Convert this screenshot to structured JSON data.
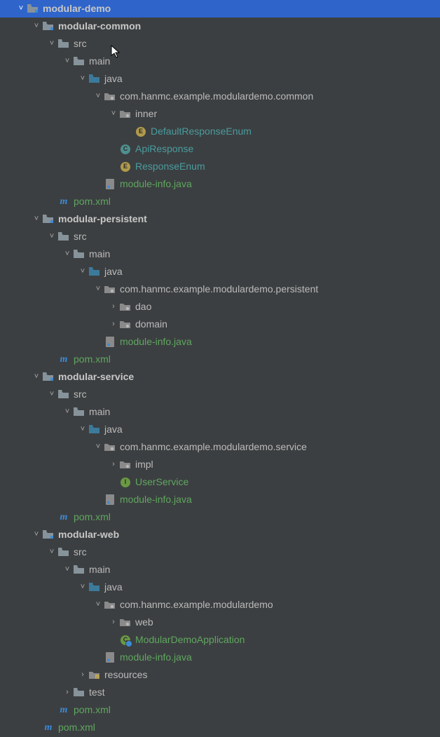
{
  "rows": [
    {
      "depth": 1,
      "arrow": "down",
      "icon": "module",
      "label": "modular-demo",
      "bold": true,
      "selected": true
    },
    {
      "depth": 2,
      "arrow": "down",
      "icon": "module",
      "label": "modular-common",
      "bold": true
    },
    {
      "depth": 3,
      "arrow": "down",
      "icon": "folder",
      "label": "src"
    },
    {
      "depth": 4,
      "arrow": "down",
      "icon": "folder",
      "label": "main"
    },
    {
      "depth": 5,
      "arrow": "down",
      "icon": "src",
      "label": "java"
    },
    {
      "depth": 6,
      "arrow": "down",
      "icon": "pkg",
      "label": "com.hanmc.example.modulardemo.common"
    },
    {
      "depth": 7,
      "arrow": "down",
      "icon": "pkg",
      "label": "inner"
    },
    {
      "depth": 8,
      "arrow": "",
      "icon": "enum",
      "label": "DefaultResponseEnum",
      "color": "teal"
    },
    {
      "depth": 7,
      "arrow": "",
      "icon": "class",
      "label": "ApiResponse",
      "color": "teal"
    },
    {
      "depth": 7,
      "arrow": "",
      "icon": "enum",
      "label": "ResponseEnum",
      "color": "teal"
    },
    {
      "depth": 6,
      "arrow": "",
      "icon": "java",
      "label": "module-info.java",
      "color": "green"
    },
    {
      "depth": 3,
      "arrow": "",
      "icon": "maven",
      "label": "pom.xml",
      "color": "green"
    },
    {
      "depth": 2,
      "arrow": "down",
      "icon": "module",
      "label": "modular-persistent",
      "bold": true
    },
    {
      "depth": 3,
      "arrow": "down",
      "icon": "folder",
      "label": "src"
    },
    {
      "depth": 4,
      "arrow": "down",
      "icon": "folder",
      "label": "main"
    },
    {
      "depth": 5,
      "arrow": "down",
      "icon": "src",
      "label": "java"
    },
    {
      "depth": 6,
      "arrow": "down",
      "icon": "pkg",
      "label": "com.hanmc.example.modulardemo.persistent"
    },
    {
      "depth": 7,
      "arrow": "right",
      "icon": "pkg",
      "label": "dao"
    },
    {
      "depth": 7,
      "arrow": "right",
      "icon": "pkg",
      "label": "domain"
    },
    {
      "depth": 6,
      "arrow": "",
      "icon": "java",
      "label": "module-info.java",
      "color": "green"
    },
    {
      "depth": 3,
      "arrow": "",
      "icon": "maven",
      "label": "pom.xml",
      "color": "green"
    },
    {
      "depth": 2,
      "arrow": "down",
      "icon": "module",
      "label": "modular-service",
      "bold": true
    },
    {
      "depth": 3,
      "arrow": "down",
      "icon": "folder",
      "label": "src"
    },
    {
      "depth": 4,
      "arrow": "down",
      "icon": "folder",
      "label": "main"
    },
    {
      "depth": 5,
      "arrow": "down",
      "icon": "src",
      "label": "java"
    },
    {
      "depth": 6,
      "arrow": "down",
      "icon": "pkg",
      "label": "com.hanmc.example.modulardemo.service"
    },
    {
      "depth": 7,
      "arrow": "right",
      "icon": "pkg",
      "label": "impl"
    },
    {
      "depth": 7,
      "arrow": "",
      "icon": "iface",
      "label": "UserService",
      "color": "green"
    },
    {
      "depth": 6,
      "arrow": "",
      "icon": "java",
      "label": "module-info.java",
      "color": "green"
    },
    {
      "depth": 3,
      "arrow": "",
      "icon": "maven",
      "label": "pom.xml",
      "color": "green"
    },
    {
      "depth": 2,
      "arrow": "down",
      "icon": "module",
      "label": "modular-web",
      "bold": true
    },
    {
      "depth": 3,
      "arrow": "down",
      "icon": "folder",
      "label": "src"
    },
    {
      "depth": 4,
      "arrow": "down",
      "icon": "folder",
      "label": "main"
    },
    {
      "depth": 5,
      "arrow": "down",
      "icon": "src",
      "label": "java"
    },
    {
      "depth": 6,
      "arrow": "down",
      "icon": "pkg",
      "label": "com.hanmc.example.modulardemo"
    },
    {
      "depth": 7,
      "arrow": "right",
      "icon": "pkg",
      "label": "web"
    },
    {
      "depth": 7,
      "arrow": "",
      "icon": "run",
      "label": "ModularDemoApplication",
      "color": "green"
    },
    {
      "depth": 6,
      "arrow": "",
      "icon": "java",
      "label": "module-info.java",
      "color": "green"
    },
    {
      "depth": 5,
      "arrow": "right",
      "icon": "res",
      "label": "resources"
    },
    {
      "depth": 4,
      "arrow": "right",
      "icon": "folder",
      "label": "test"
    },
    {
      "depth": 3,
      "arrow": "",
      "icon": "maven",
      "label": "pom.xml",
      "color": "green"
    },
    {
      "depth": 2,
      "arrow": "",
      "icon": "maven",
      "label": "pom.xml",
      "color": "green"
    }
  ],
  "icon_semantics": {
    "module": "module-folder-icon",
    "folder": "folder-icon",
    "src": "source-root-folder-icon",
    "pkg": "package-icon",
    "enum": "enum-class-icon",
    "class": "class-icon",
    "iface": "interface-icon",
    "java": "java-file-icon",
    "maven": "maven-pom-icon",
    "res": "resources-folder-icon",
    "run": "runnable-class-icon"
  },
  "arrows": {
    "down": "˅",
    "right": "›"
  }
}
